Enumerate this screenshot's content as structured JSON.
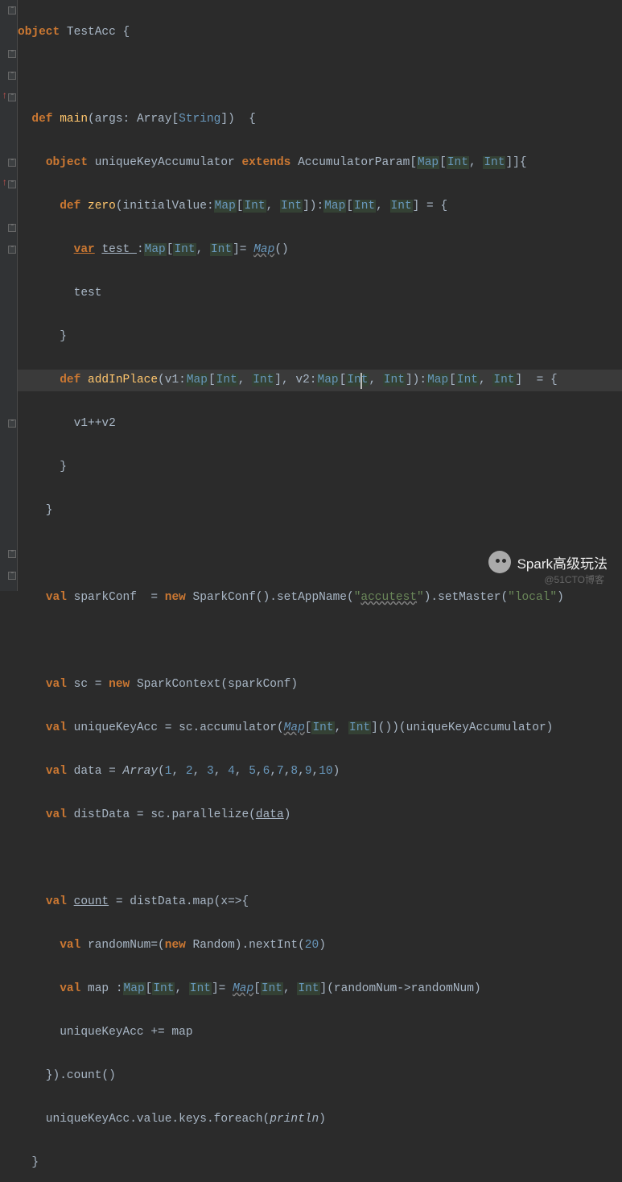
{
  "editor": {
    "language": "scala",
    "highlighted_line_index": 8,
    "lines": [
      "object TestAcc {",
      "",
      "  def main(args: Array[String])  {",
      "    object uniqueKeyAccumulator extends AccumulatorParam[Map[Int, Int]]{",
      "      def zero(initialValue:Map[Int, Int]):Map[Int, Int] = {",
      "        var test :Map[Int, Int]= Map()",
      "        test",
      "      }",
      "      def addInPlace(v1:Map[Int, Int], v2:Map[Int, Int]):Map[Int, Int]  = {",
      "        v1++v2",
      "      }",
      "    }",
      "",
      "    val sparkConf  = new SparkConf().setAppName(\"accutest\").setMaster(\"local\")",
      "",
      "    val sc = new SparkContext(sparkConf)",
      "    val uniqueKeyAcc = sc.accumulator(Map[Int, Int]())(uniqueKeyAccumulator)",
      "    val data = Array(1, 2, 3, 4, 5,6,7,8,9,10)",
      "    val distData = sc.parallelize(data)",
      "",
      "    val count = distData.map(x=>{",
      "      val randomNum=(new Random).nextInt(20)",
      "      val map :Map[Int, Int]= Map[Int, Int](randomNum->randomNum)",
      "      uniqueKeyAcc += map",
      "    }).count()",
      "    uniqueKeyAcc.value.keys.foreach(println)",
      "  }"
    ],
    "gutter_markers": {
      "4": "up-arrow",
      "8": "up-arrow"
    },
    "caret": {
      "line": 8,
      "col": 52
    }
  },
  "watermark": {
    "text": "Spark高级玩法",
    "subtitle": "@51CTO博客"
  },
  "colors": {
    "bg": "#2b2b2b",
    "gutter": "#313335",
    "keyword": "#cc7832",
    "type_hl": "#6897bb",
    "string": "#6a8759",
    "number": "#6897bb",
    "identifier": "#ffc66d",
    "text": "#a9b7c6",
    "hl_line": "#3a3a3a"
  }
}
